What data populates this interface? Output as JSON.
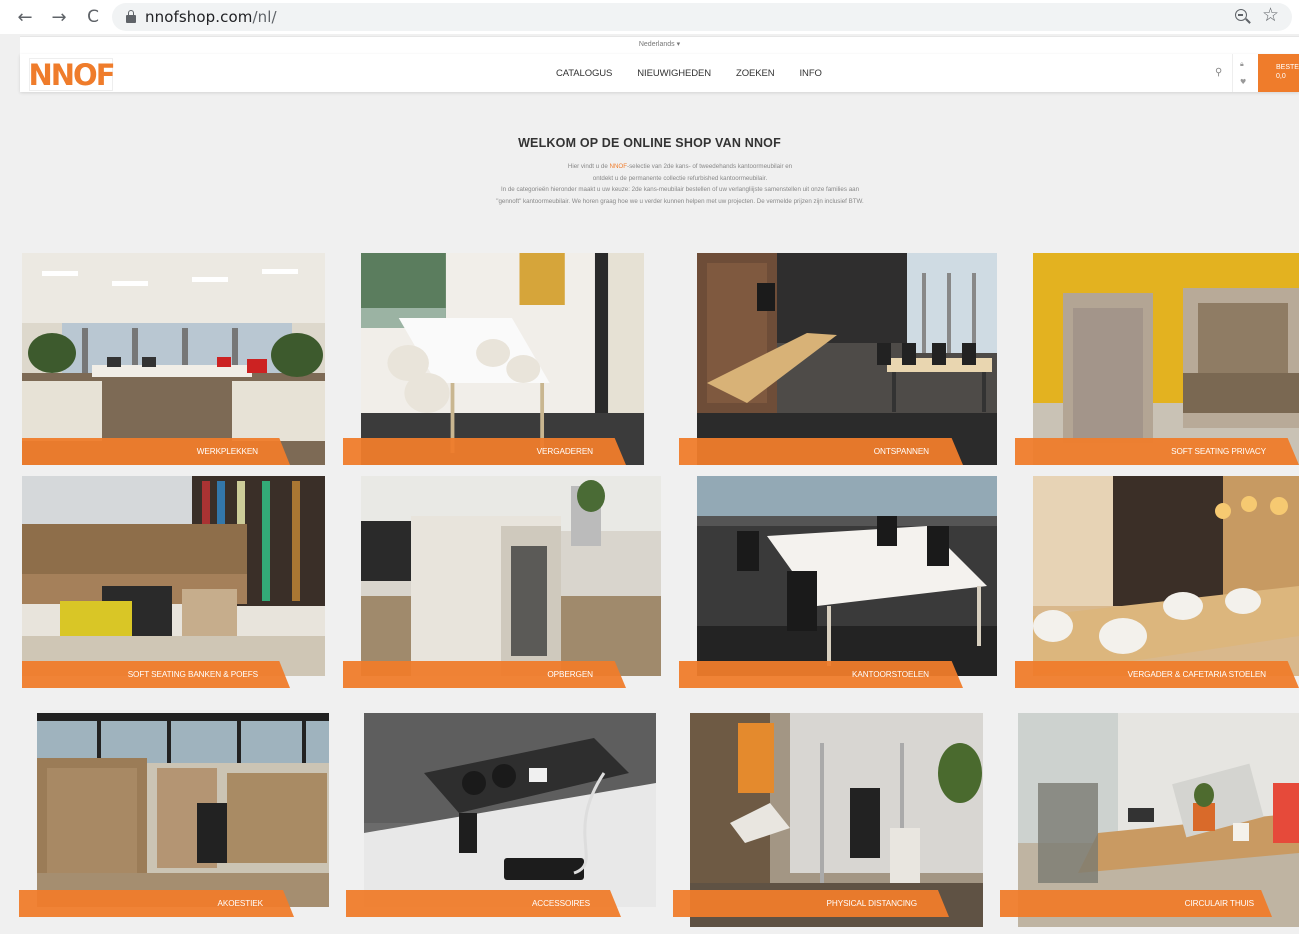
{
  "browser": {
    "url_domain": "nnofshop.com",
    "url_path": "/nl/",
    "back_icon": "←",
    "forward_icon": "→",
    "reload_icon": "C",
    "star_icon": "☆"
  },
  "site": {
    "language": "Nederlands ▾",
    "logo_text": "NNOF",
    "menu": [
      "CATALOGUS",
      "NIEUWIGHEDEN",
      "ZOEKEN",
      "INFO"
    ],
    "order_button": "BESTE 0,0",
    "brand_color": "#ef7c2b"
  },
  "welcome": {
    "title": "WELKOM OP DE ONLINE SHOP VAN NNOF",
    "line1_pre": "Hier vindt u de ",
    "line1_brand": "NNOF",
    "line1_post": "-selectie van 2de kans- of tweedehands kantoormeubilair en",
    "line2": "ontdekt u de permanente collectie refurbished kantoormeubilair.",
    "line3": "In de categorieën hieronder maakt u uw keuze: 2de kans-meubilair bestellen of uw verlangliijste samenstellen uit onze families aan",
    "line4": "\"gennoft\" kantoormeubilair. We horen graag hoe we u verder kunnen helpen met uw projecten. De vermelde prijzen zijn inclusief BTW."
  },
  "categories": [
    {
      "label": "WERKPLEKKEN"
    },
    {
      "label": "VERGADEREN"
    },
    {
      "label": "ONTSPANNEN"
    },
    {
      "label": "SOFT SEATING PRIVACY"
    },
    {
      "label": "SOFT SEATING BANKEN & POEFS"
    },
    {
      "label": "OPBERGEN"
    },
    {
      "label": "KANTOORSTOELEN"
    },
    {
      "label": "VERGADER & CAFETARIA STOELEN"
    },
    {
      "label": "AKOESTIEK"
    },
    {
      "label": "ACCESSOIRES"
    },
    {
      "label": "PHYSICAL DISTANCING"
    },
    {
      "label": "CIRCULAIR THUIS"
    }
  ]
}
